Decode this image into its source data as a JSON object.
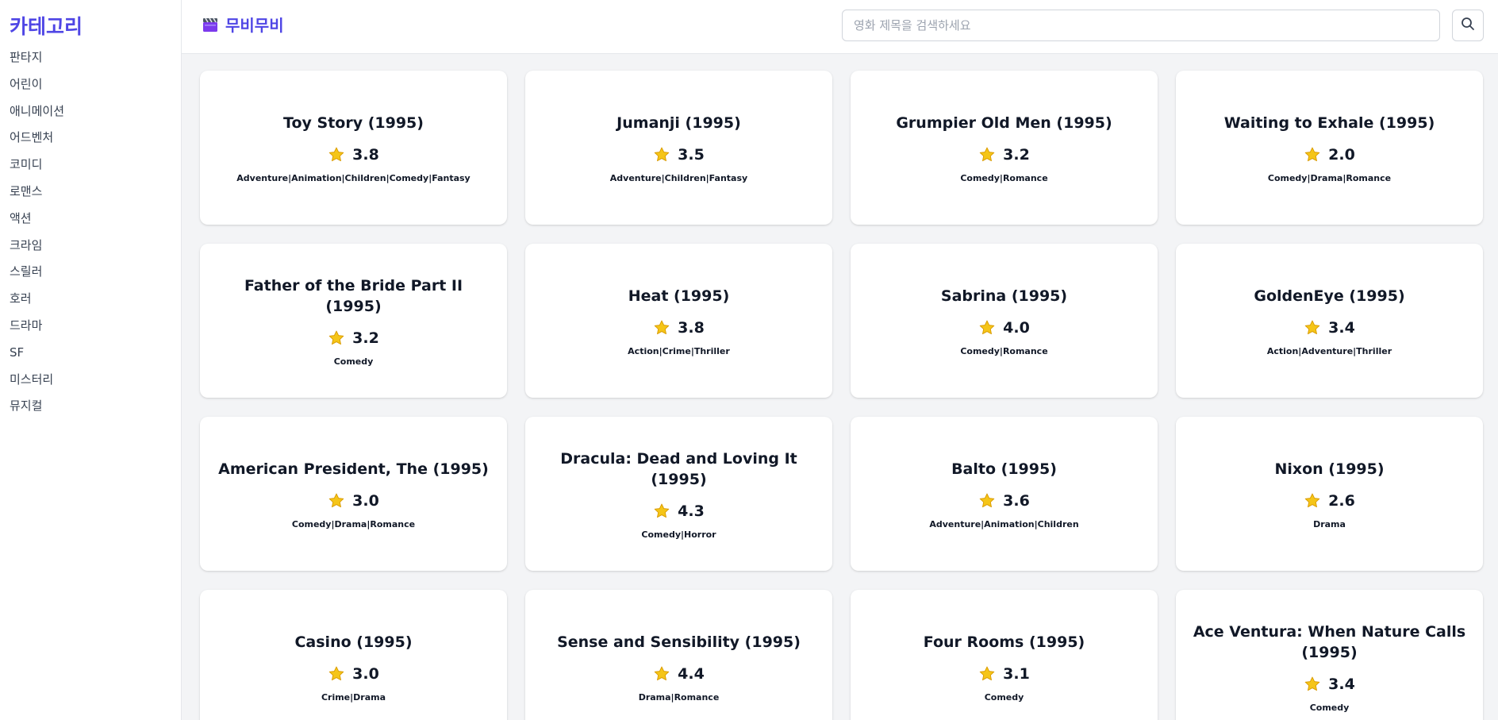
{
  "sidebar": {
    "title": "카테고리",
    "categories": [
      "판타지",
      "어린이",
      "애니메이션",
      "어드벤처",
      "코미디",
      "로맨스",
      "액션",
      "크라임",
      "스릴러",
      "호러",
      "드라마",
      "SF",
      "미스터리",
      "뮤지컬"
    ]
  },
  "header": {
    "app_name": "무비무비",
    "logo_icon": "clapperboard-icon",
    "search_placeholder": "영화 제목을 검색하세요",
    "search_value": "",
    "search_button_icon": "search-icon"
  },
  "colors": {
    "accent": "#4f46e5",
    "star": "#f5c518",
    "background": "#f3f4f6"
  },
  "movies": [
    {
      "title": "Toy Story (1995)",
      "rating": "3.8",
      "genres": "Adventure|Animation|Children|Comedy|Fantasy"
    },
    {
      "title": "Jumanji (1995)",
      "rating": "3.5",
      "genres": "Adventure|Children|Fantasy"
    },
    {
      "title": "Grumpier Old Men (1995)",
      "rating": "3.2",
      "genres": "Comedy|Romance"
    },
    {
      "title": "Waiting to Exhale (1995)",
      "rating": "2.0",
      "genres": "Comedy|Drama|Romance"
    },
    {
      "title": "Father of the Bride Part II (1995)",
      "rating": "3.2",
      "genres": "Comedy"
    },
    {
      "title": "Heat (1995)",
      "rating": "3.8",
      "genres": "Action|Crime|Thriller"
    },
    {
      "title": "Sabrina (1995)",
      "rating": "4.0",
      "genres": "Comedy|Romance"
    },
    {
      "title": "GoldenEye (1995)",
      "rating": "3.4",
      "genres": "Action|Adventure|Thriller"
    },
    {
      "title": "American President, The (1995)",
      "rating": "3.0",
      "genres": "Comedy|Drama|Romance"
    },
    {
      "title": "Dracula: Dead and Loving It (1995)",
      "rating": "4.3",
      "genres": "Comedy|Horror"
    },
    {
      "title": "Balto (1995)",
      "rating": "3.6",
      "genres": "Adventure|Animation|Children"
    },
    {
      "title": "Nixon (1995)",
      "rating": "2.6",
      "genres": "Drama"
    },
    {
      "title": "Casino (1995)",
      "rating": "3.0",
      "genres": "Crime|Drama"
    },
    {
      "title": "Sense and Sensibility (1995)",
      "rating": "4.4",
      "genres": "Drama|Romance"
    },
    {
      "title": "Four Rooms (1995)",
      "rating": "3.1",
      "genres": "Comedy"
    },
    {
      "title": "Ace Ventura: When Nature Calls (1995)",
      "rating": "3.4",
      "genres": "Comedy"
    }
  ]
}
